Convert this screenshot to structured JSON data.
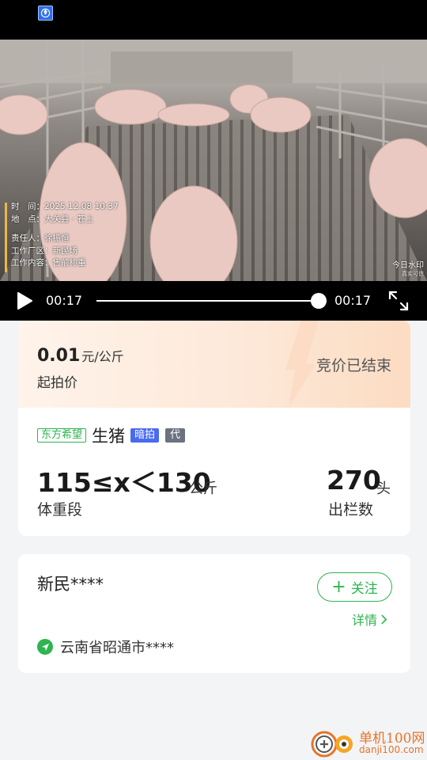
{
  "status_bar": {
    "app_icon": "recycle-app-icon"
  },
  "video": {
    "watermark": {
      "time_label": "时　间：",
      "time_value": "2025.12.08 10:37",
      "place_label": "地　点：",
      "place_value": "大关县 · 苍上",
      "owner_label": "责任人：",
      "owner_value": "徐振恒",
      "area_label": "工作厂区：",
      "area_value": "新民场",
      "content_label": "工作内容：",
      "content_value": "售前称重",
      "logo_text": "今日水印",
      "logo_sub": "真实可信"
    },
    "controls": {
      "current_time": "00:17",
      "duration": "00:17",
      "progress": 1.0
    }
  },
  "auction": {
    "price": "0.01",
    "price_unit": "元/公斤",
    "price_label": "起拍价",
    "status": "竞价已结束",
    "brand_tag": "东方希望",
    "product": "生猪",
    "badge_mode": "暗拍",
    "badge_agent": "代",
    "weight_range": "115≤x＜130",
    "weight_unit": "公斤",
    "weight_label": "体重段",
    "head_count": "270",
    "head_unit": "头",
    "head_label": "出栏数",
    "colors": {
      "accent_green": "#2eb450",
      "badge_blue": "#4a6bef",
      "header_peach": "#fde9da"
    }
  },
  "seller": {
    "name": "新民****",
    "follow_label": "关注",
    "detail_label": "详情",
    "location": "云南省昭通市****"
  },
  "site_watermark": {
    "name": "单机100网",
    "url": "danji100.com"
  }
}
